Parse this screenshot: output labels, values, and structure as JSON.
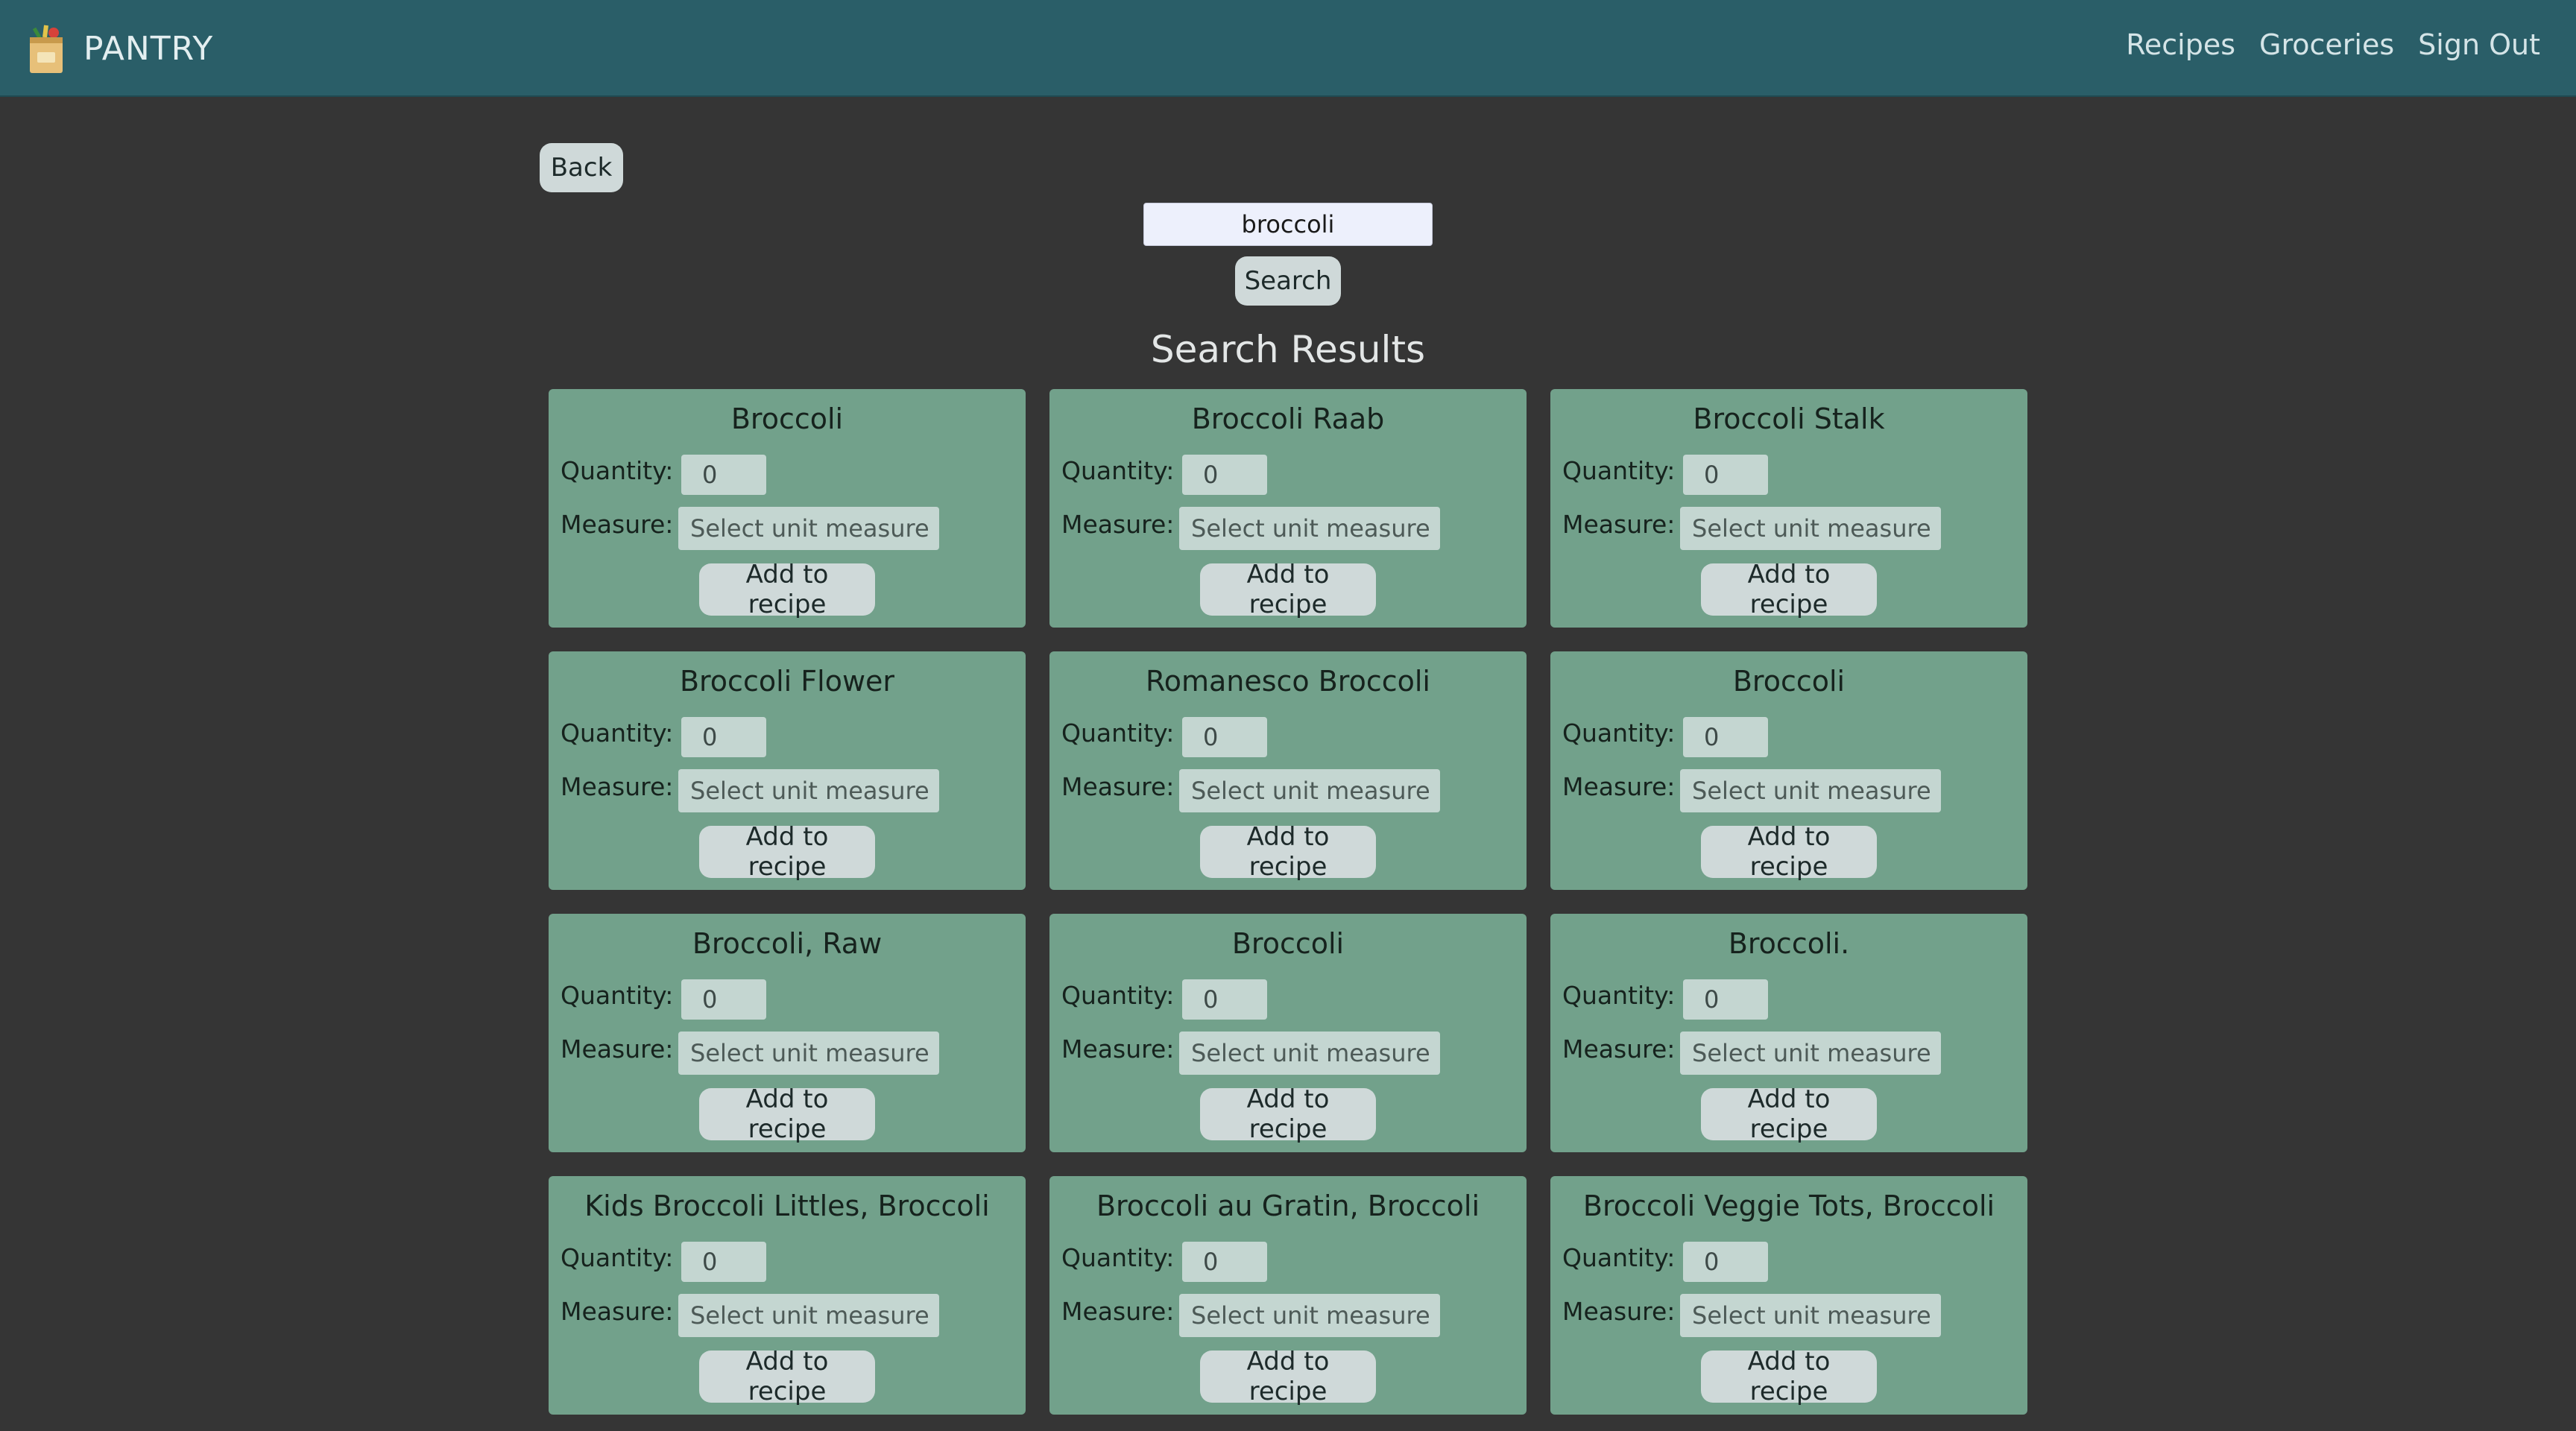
{
  "nav": {
    "brand": "PANTRY",
    "links": [
      "Recipes",
      "Groceries",
      "Sign Out"
    ]
  },
  "back_label": "Back",
  "search": {
    "value": "broccoli",
    "button_label": "Search"
  },
  "results_title": "Search Results",
  "labels": {
    "quantity": "Quantity:",
    "measure": "Measure:",
    "measure_placeholder": "Select unit measure",
    "add": "Add to recipe"
  },
  "results": [
    {
      "name": "Broccoli",
      "quantity": "0"
    },
    {
      "name": "Broccoli Raab",
      "quantity": "0"
    },
    {
      "name": "Broccoli Stalk",
      "quantity": "0"
    },
    {
      "name": "Broccoli Flower",
      "quantity": "0"
    },
    {
      "name": "Romanesco Broccoli",
      "quantity": "0"
    },
    {
      "name": "Broccoli",
      "quantity": "0"
    },
    {
      "name": "Broccoli, Raw",
      "quantity": "0"
    },
    {
      "name": "Broccoli",
      "quantity": "0"
    },
    {
      "name": "Broccoli.",
      "quantity": "0"
    },
    {
      "name": "Kids Broccoli Littles, Broccoli",
      "quantity": "0"
    },
    {
      "name": "Broccoli au Gratin, Broccoli",
      "quantity": "0"
    },
    {
      "name": "Broccoli Veggie Tots, Broccoli",
      "quantity": "0"
    }
  ]
}
